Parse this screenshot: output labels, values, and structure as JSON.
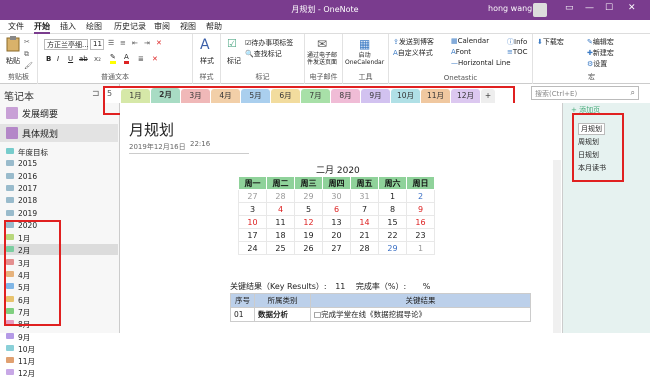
{
  "window": {
    "title": "月规划 - OneNote",
    "user": "hong wang"
  },
  "menu": [
    "文件",
    "开始",
    "插入",
    "绘图",
    "历史记录",
    "审阅",
    "视图",
    "帮助"
  ],
  "ribbon": {
    "paste": "粘贴",
    "font_name": "方正兰亭细...",
    "font_size": "11",
    "bold": "B",
    "italic": "I",
    "underline": "U",
    "style_label": "样式",
    "tag_label": "标记",
    "todo_tag": "待办事项标签",
    "find_tag": "查找标记",
    "email_label": "通过电子邮\n件发送页面",
    "onecalendar": "启动\nOneCalendar",
    "send_to": "发送到博客",
    "custom_style": "自定义样式",
    "calendar": "Calendar",
    "font": "Font",
    "horizontal_line": "Horizontal Line",
    "info": "Info",
    "toc": "TOC",
    "download": "下载宏",
    "edit_macro": "编辑宏",
    "new_macro": "新建宏",
    "settings": "设置",
    "groups": {
      "clipboard": "剪贴板",
      "basic_text": "普通文本",
      "styles": "样式",
      "tags": "标记",
      "email": "电子邮件",
      "tools": "工具",
      "onetastic": "Onetastic",
      "macros": "宏"
    }
  },
  "sidebar": {
    "header": "笔记本",
    "notebooks": [
      {
        "name": "发展纲要",
        "color": "#c8a0d6"
      },
      {
        "name": "具体规划",
        "color": "#b487c8"
      }
    ],
    "sections": [
      {
        "name": "年度目标",
        "color": "#7cc"
      },
      {
        "name": "2015",
        "color": "#9bc"
      },
      {
        "name": "2016",
        "color": "#9bc"
      },
      {
        "name": "2017",
        "color": "#9bc"
      },
      {
        "name": "2018",
        "color": "#9bc"
      },
      {
        "name": "2019",
        "color": "#9bc"
      },
      {
        "name": "2020",
        "color": "#9bc"
      },
      {
        "name": "1月",
        "color": "#b8d77c"
      },
      {
        "name": "2月",
        "color": "#7ccda0"
      },
      {
        "name": "3月",
        "color": "#e48f8f"
      },
      {
        "name": "4月",
        "color": "#e6b27c"
      },
      {
        "name": "5月",
        "color": "#80b6e6"
      },
      {
        "name": "6月",
        "color": "#e8c36e"
      },
      {
        "name": "7月",
        "color": "#7fcf7f"
      },
      {
        "name": "8月",
        "color": "#e69bc0"
      },
      {
        "name": "9月",
        "color": "#b49ae6"
      },
      {
        "name": "10月",
        "color": "#8ad0d8"
      },
      {
        "name": "11月",
        "color": "#e0a070"
      },
      {
        "name": "12月",
        "color": "#c8a8e6"
      }
    ]
  },
  "tabs": [
    {
      "label": "1月",
      "color": "#d6e8a8"
    },
    {
      "label": "2月",
      "color": "#a8dcc4"
    },
    {
      "label": "3月",
      "color": "#f0b8b8"
    },
    {
      "label": "4月",
      "color": "#f2cfa8"
    },
    {
      "label": "5月",
      "color": "#aacfee"
    },
    {
      "label": "6月",
      "color": "#f2dc9e"
    },
    {
      "label": "7月",
      "color": "#a8e0a8"
    },
    {
      "label": "8月",
      "color": "#f0bcd6"
    },
    {
      "label": "9月",
      "color": "#d2c2f0"
    },
    {
      "label": "10月",
      "color": "#b0e0e6"
    },
    {
      "label": "11月",
      "color": "#f0c8a0"
    },
    {
      "label": "12月",
      "color": "#dcc8f0"
    }
  ],
  "tab_add": "+",
  "tab_scroll_num": "5",
  "search": {
    "placeholder": "搜索(Ctrl+E)"
  },
  "pages_panel": {
    "add_page": "+ 添加页",
    "pages": [
      "月规划",
      "周规划",
      "日规划",
      "本月读书"
    ]
  },
  "page": {
    "title": "月规划",
    "date": "2019年12月16日",
    "time": "22:16",
    "calendar": {
      "title": "二月 2020",
      "weekdays": [
        "周一",
        "周二",
        "周三",
        "周四",
        "周五",
        "周六",
        "周日"
      ],
      "weeks": [
        [
          "27",
          "28",
          "29",
          "30",
          "31",
          "1",
          "2"
        ],
        [
          "3",
          "4",
          "5",
          "6",
          "7",
          "8",
          "9"
        ],
        [
          "10",
          "11",
          "12",
          "13",
          "14",
          "15",
          "16"
        ],
        [
          "17",
          "18",
          "19",
          "20",
          "21",
          "22",
          "23"
        ],
        [
          "24",
          "25",
          "26",
          "27",
          "28",
          "29",
          "1"
        ]
      ],
      "colors": [
        [
          "#999",
          "#999",
          "#999",
          "#999",
          "#999",
          "#222",
          "#3a6fc4"
        ],
        [
          "#222",
          "#d22",
          "#222",
          "#d22",
          "#222",
          "#222",
          "#d22"
        ],
        [
          "#d22",
          "#222",
          "#d22",
          "#222",
          "#d22",
          "#222",
          "#d22"
        ],
        [
          "#222",
          "#222",
          "#222",
          "#222",
          "#222",
          "#222",
          "#222"
        ],
        [
          "#222",
          "#222",
          "#222",
          "#222",
          "#222",
          "#3a6fc4",
          "#999"
        ]
      ]
    },
    "key_results": {
      "label": "关键结果（Key Results）:",
      "count": "11",
      "rate_label": "完成率（%）:",
      "rate_unit": "%"
    },
    "kr_table": {
      "headers": [
        "序号",
        "所属类别",
        "关键结果"
      ],
      "rows": [
        [
          "01",
          "数据分析",
          "□完成学堂在线《数据挖掘导论》"
        ]
      ]
    }
  }
}
